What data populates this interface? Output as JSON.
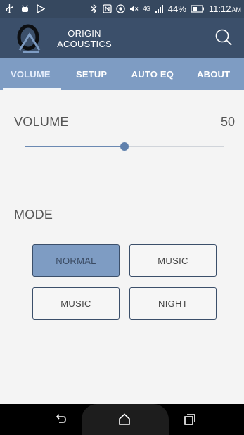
{
  "status_bar": {
    "battery": "44%",
    "time": "11:12",
    "ampm": "AM",
    "network": "4G"
  },
  "header": {
    "brand_line1": "ORIGIN",
    "brand_line2": "ACOUSTICS",
    "logo_icon": "origin-acoustics-logo",
    "search_icon": "search-icon"
  },
  "tabs": [
    {
      "label": "VOLUME",
      "active": true
    },
    {
      "label": "SETUP",
      "active": false
    },
    {
      "label": "AUTO EQ",
      "active": false
    },
    {
      "label": "ABOUT",
      "active": false
    }
  ],
  "volume": {
    "label": "VOLUME",
    "value": "50",
    "level_fraction": 0.5
  },
  "mode": {
    "label": "MODE",
    "options": [
      {
        "label": "NORMAL",
        "selected": true
      },
      {
        "label": "MUSIC",
        "selected": false
      },
      {
        "label": "MUSIC",
        "selected": false
      },
      {
        "label": "NIGHT",
        "selected": false
      }
    ]
  },
  "colors": {
    "header_bg": "#3b4f6a",
    "tab_bg": "#7e9cc3",
    "selected_button": "#7e9cc3",
    "slider_thumb": "#5f80ac"
  },
  "nav_icons": [
    "back-icon",
    "home-icon",
    "recent-apps-icon"
  ]
}
